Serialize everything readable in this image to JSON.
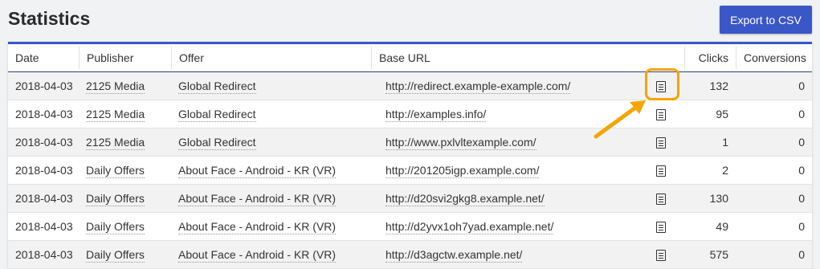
{
  "page": {
    "title": "Statistics",
    "export_label": "Export to CSV"
  },
  "table": {
    "columns": [
      "Date",
      "Publisher",
      "Offer",
      "Base URL",
      "",
      "Clicks",
      "Conversions"
    ],
    "rows": [
      {
        "date": "2018-04-03",
        "publisher": "2125 Media",
        "offer": "Global Redirect",
        "url": "http://redirect.example-example.com/",
        "clicks": "132",
        "conversions": "0"
      },
      {
        "date": "2018-04-03",
        "publisher": "2125 Media",
        "offer": "Global Redirect",
        "url": "http://examples.info/",
        "clicks": "95",
        "conversions": "0"
      },
      {
        "date": "2018-04-03",
        "publisher": "2125 Media",
        "offer": "Global Redirect",
        "url": "http://www.pxlvltexample.com/",
        "clicks": "1",
        "conversions": "0"
      },
      {
        "date": "2018-04-03",
        "publisher": "Daily Offers",
        "offer": "About Face - Android - KR (VR)",
        "url": "http://201205igp.example.com/",
        "clicks": "2",
        "conversions": "0"
      },
      {
        "date": "2018-04-03",
        "publisher": "Daily Offers",
        "offer": "About Face - Android - KR (VR)",
        "url": "http://d20svi2gkg8.example.net/",
        "clicks": "130",
        "conversions": "0"
      },
      {
        "date": "2018-04-03",
        "publisher": "Daily Offers",
        "offer": "About Face - Android - KR (VR)",
        "url": "http://d2yvx1oh7yad.example.net/",
        "clicks": "49",
        "conversions": "0"
      },
      {
        "date": "2018-04-03",
        "publisher": "Daily Offers",
        "offer": "About Face - Android - KR (VR)",
        "url": "http://d3agctw.example.net/",
        "clicks": "575",
        "conversions": "0"
      }
    ]
  },
  "icons": {
    "row_action": "document-list-icon",
    "callout": "arrow-icon"
  },
  "colors": {
    "accent": "#3a57c8",
    "highlight": "#f5a500"
  }
}
